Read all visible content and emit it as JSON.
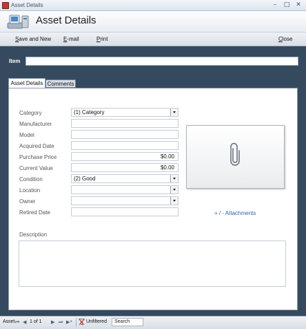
{
  "window": {
    "title": "Asset Details",
    "controls": [
      "minimize-icon",
      "maximize-icon",
      "close-icon"
    ]
  },
  "header": {
    "title": "Asset Details",
    "icon": "asset-form-icon"
  },
  "toolbar": {
    "save_and_new": "Save and New",
    "email": "E-mail",
    "print": "Print",
    "close": "Close"
  },
  "item": {
    "label": "Item",
    "value": ""
  },
  "tabs": [
    {
      "label": "Asset Details",
      "active": true
    },
    {
      "label": "Comments",
      "active": false
    }
  ],
  "fields": {
    "category": {
      "label": "Category",
      "value": "(1) Category",
      "type": "dropdown"
    },
    "manufacturer": {
      "label": "Manufacturer",
      "value": ""
    },
    "model": {
      "label": "Model",
      "value": ""
    },
    "acquired_date": {
      "label": "Acquired Date",
      "value": ""
    },
    "purchase_price": {
      "label": "Purchase Price",
      "value": "$0.00"
    },
    "current_value": {
      "label": "Current Value",
      "value": "$0.00"
    },
    "condition": {
      "label": "Condition",
      "value": "(2) Good",
      "type": "dropdown"
    },
    "location": {
      "label": "Location",
      "value": "",
      "type": "dropdown"
    },
    "owner": {
      "label": "Owner",
      "value": "",
      "type": "dropdown"
    },
    "retired_date": {
      "label": "Retired Date",
      "value": ""
    }
  },
  "attachments": {
    "icon": "paperclip-icon",
    "link_label": "+ / -  Attachments"
  },
  "description": {
    "label": "Description",
    "value": ""
  },
  "statusbar": {
    "record_label": "Asset",
    "position": "1 of 1",
    "filter_label": "Unfiltered",
    "search_label": "Search"
  },
  "colors": {
    "main_background": "#354a5e",
    "link": "#2b63a8"
  }
}
